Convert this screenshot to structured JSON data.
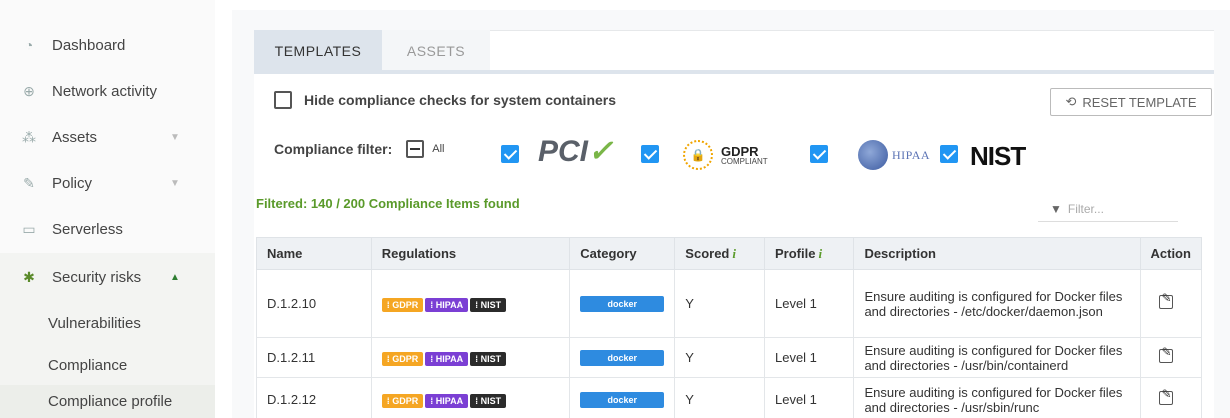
{
  "sidebar": {
    "items": [
      {
        "label": "Dashboard",
        "icon": "dashboard-icon"
      },
      {
        "label": "Network activity",
        "icon": "globe-icon"
      },
      {
        "label": "Assets",
        "icon": "assets-icon"
      },
      {
        "label": "Policy",
        "icon": "policy-icon"
      },
      {
        "label": "Serverless",
        "icon": "laptop-icon"
      },
      {
        "label": "Security risks",
        "icon": "bug-icon"
      }
    ],
    "sub_items": [
      {
        "label": "Vulnerabilities"
      },
      {
        "label": "Compliance"
      },
      {
        "label": "Compliance profile"
      }
    ]
  },
  "tabs": {
    "templates": "TEMPLATES",
    "assets": "ASSETS"
  },
  "hide_checks_label": "Hide compliance checks for system containers",
  "reset_button": "RESET TEMPLATE",
  "compliance_filter": {
    "label": "Compliance filter:",
    "all_label": "All",
    "logos": {
      "pci": "PCI",
      "gdpr_line1": "GDPR",
      "gdpr_line2": "COMPLIANT",
      "hipaa": "HIPAA",
      "nist": "NIST"
    }
  },
  "filtered_text": "Filtered: 140 / 200 Compliance Items found",
  "filter_placeholder": "Filter...",
  "table": {
    "headers": {
      "name": "Name",
      "regulations": "Regulations",
      "category": "Category",
      "scored": "Scored",
      "profile": "Profile",
      "description": "Description",
      "action": "Action",
      "info": "i"
    },
    "rows": [
      {
        "name": "D.1.2.10",
        "tags": [
          "GDPR",
          "HIPAA",
          "NIST"
        ],
        "category": "docker",
        "scored": "Y",
        "profile": "Level 1",
        "description": "Ensure auditing is configured for Docker files and directories - /etc/docker/daemon.json"
      },
      {
        "name": "D.1.2.11",
        "tags": [
          "GDPR",
          "HIPAA",
          "NIST"
        ],
        "category": "docker",
        "scored": "Y",
        "profile": "Level 1",
        "description": "Ensure auditing is configured for Docker files and directories - /usr/bin/containerd"
      },
      {
        "name": "D.1.2.12",
        "tags": [
          "GDPR",
          "HIPAA",
          "NIST"
        ],
        "category": "docker",
        "scored": "Y",
        "profile": "Level 1",
        "description": "Ensure auditing is configured for Docker files and directories - /usr/sbin/runc"
      }
    ]
  },
  "colors": {
    "accent_green": "#5a9a2a",
    "checkbox_blue": "#2196f3",
    "gdpr_orange": "#f5a623",
    "hipaa_purple": "#7b3fd4",
    "nist_dark": "#2b2b2b",
    "category_blue": "#2e8be0"
  }
}
